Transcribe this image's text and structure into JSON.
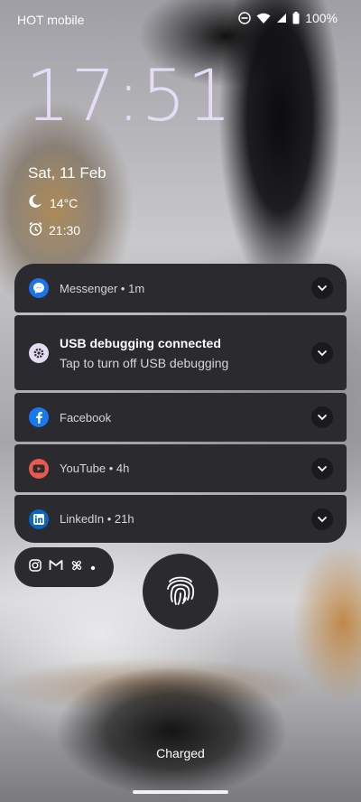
{
  "status": {
    "carrier": "HOT mobile",
    "battery": "100%"
  },
  "lockscreen": {
    "time": "17:51",
    "date": "Sat, 11 Feb",
    "temperature": "14°C",
    "alarm": "21:30",
    "status_text": "Charged"
  },
  "notifications": [
    {
      "app": "Messenger",
      "text": "Messenger • 1m",
      "color": "#1a73e8"
    },
    {
      "app": "USB",
      "title": "USB debugging connected",
      "subtitle": "Tap to turn off USB debugging"
    },
    {
      "app": "Facebook",
      "text": "Facebook",
      "color": "#1877f2"
    },
    {
      "app": "YouTube",
      "text": "YouTube • 4h",
      "color": "#e85a4f"
    },
    {
      "app": "LinkedIn",
      "text": "LinkedIn • 21h",
      "color": "#0a66c2"
    }
  ],
  "shelf": {
    "icons": [
      "instagram-icon",
      "gmail-icon",
      "pinwheel-icon",
      "more-dot-icon"
    ]
  }
}
